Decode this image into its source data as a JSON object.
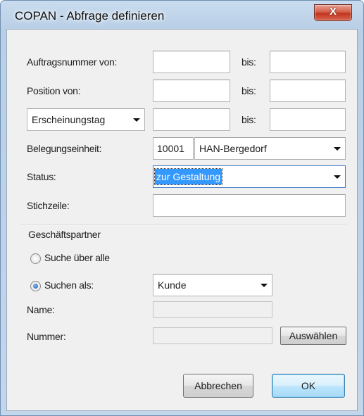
{
  "window": {
    "title": "COPAN - Abfrage definieren",
    "close_symbol": "X"
  },
  "form": {
    "auftragsnummer_label": "Auftragsnummer von:",
    "auftragsnummer_from": "",
    "auftragsnummer_to_label": "bis:",
    "auftragsnummer_to": "",
    "position_label": "Position von:",
    "position_from": "",
    "position_to_label": "bis:",
    "position_to": "",
    "date_type_selected": "Erscheinungstag",
    "date_from": "",
    "date_to_label": "bis:",
    "date_to": "",
    "belegung_label": "Belegungseinheit:",
    "belegung_code": "10001",
    "belegung_name": "HAN-Bergedorf",
    "status_label": "Status:",
    "status_selected": "zur Gestaltung",
    "stichzeile_label": "Stichzeile:",
    "stichzeile_value": ""
  },
  "partner": {
    "group_title": "Geschäftspartner",
    "radio_all_label": "Suche über alle",
    "radio_as_label": "Suchen als:",
    "radio_selected": "suchen-als",
    "role_selected": "Kunde",
    "name_label": "Name:",
    "name_value": "",
    "number_label": "Nummer:",
    "number_value": "",
    "select_button": "Auswählen"
  },
  "buttons": {
    "cancel": "Abbrechen",
    "ok": "OK"
  },
  "colors": {
    "accent": "#3399ff",
    "close": "#c7402a",
    "titlebar": "#bcd2e9"
  }
}
